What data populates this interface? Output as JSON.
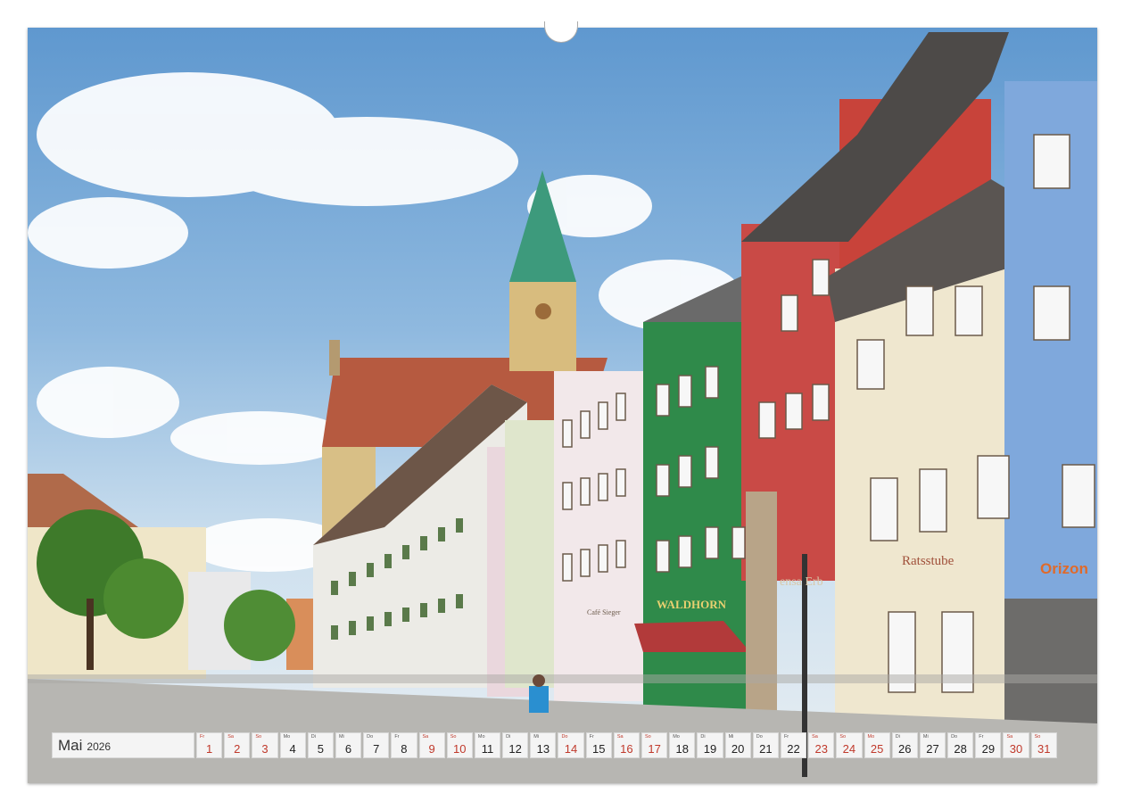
{
  "calendar": {
    "month": "Mai",
    "year": "2026",
    "days": [
      {
        "wd": "Fr",
        "n": "1",
        "red": true
      },
      {
        "wd": "Sa",
        "n": "2",
        "red": true
      },
      {
        "wd": "So",
        "n": "3",
        "red": true
      },
      {
        "wd": "Mo",
        "n": "4",
        "red": false
      },
      {
        "wd": "Di",
        "n": "5",
        "red": false
      },
      {
        "wd": "Mi",
        "n": "6",
        "red": false
      },
      {
        "wd": "Do",
        "n": "7",
        "red": false
      },
      {
        "wd": "Fr",
        "n": "8",
        "red": false
      },
      {
        "wd": "Sa",
        "n": "9",
        "red": true
      },
      {
        "wd": "So",
        "n": "10",
        "red": true
      },
      {
        "wd": "Mo",
        "n": "11",
        "red": false
      },
      {
        "wd": "Di",
        "n": "12",
        "red": false
      },
      {
        "wd": "Mi",
        "n": "13",
        "red": false
      },
      {
        "wd": "Do",
        "n": "14",
        "red": true
      },
      {
        "wd": "Fr",
        "n": "15",
        "red": false
      },
      {
        "wd": "Sa",
        "n": "16",
        "red": true
      },
      {
        "wd": "So",
        "n": "17",
        "red": true
      },
      {
        "wd": "Mo",
        "n": "18",
        "red": false
      },
      {
        "wd": "Di",
        "n": "19",
        "red": false
      },
      {
        "wd": "Mi",
        "n": "20",
        "red": false
      },
      {
        "wd": "Do",
        "n": "21",
        "red": false
      },
      {
        "wd": "Fr",
        "n": "22",
        "red": false
      },
      {
        "wd": "Sa",
        "n": "23",
        "red": true
      },
      {
        "wd": "So",
        "n": "24",
        "red": true
      },
      {
        "wd": "Mo",
        "n": "25",
        "red": true
      },
      {
        "wd": "Di",
        "n": "26",
        "red": false
      },
      {
        "wd": "Mi",
        "n": "27",
        "red": false
      },
      {
        "wd": "Do",
        "n": "28",
        "red": false
      },
      {
        "wd": "Fr",
        "n": "29",
        "red": false
      },
      {
        "wd": "Sa",
        "n": "30",
        "red": true
      },
      {
        "wd": "So",
        "n": "31",
        "red": true
      }
    ]
  },
  "photo_signs": {
    "waldhorn": "WALDHORN",
    "orizon": "Orizon",
    "cafe": "Café Sieger",
    "ratsstube": "Ratsstube",
    "erb": "ensa Erb"
  },
  "colors": {
    "holiday_red": "#c0392b",
    "sky": "#5f98cf",
    "green_facade": "#2f8a4a",
    "red_facade": "#c94a46",
    "blue_facade": "#7fa8dc",
    "spire": "#3d9a7c"
  }
}
